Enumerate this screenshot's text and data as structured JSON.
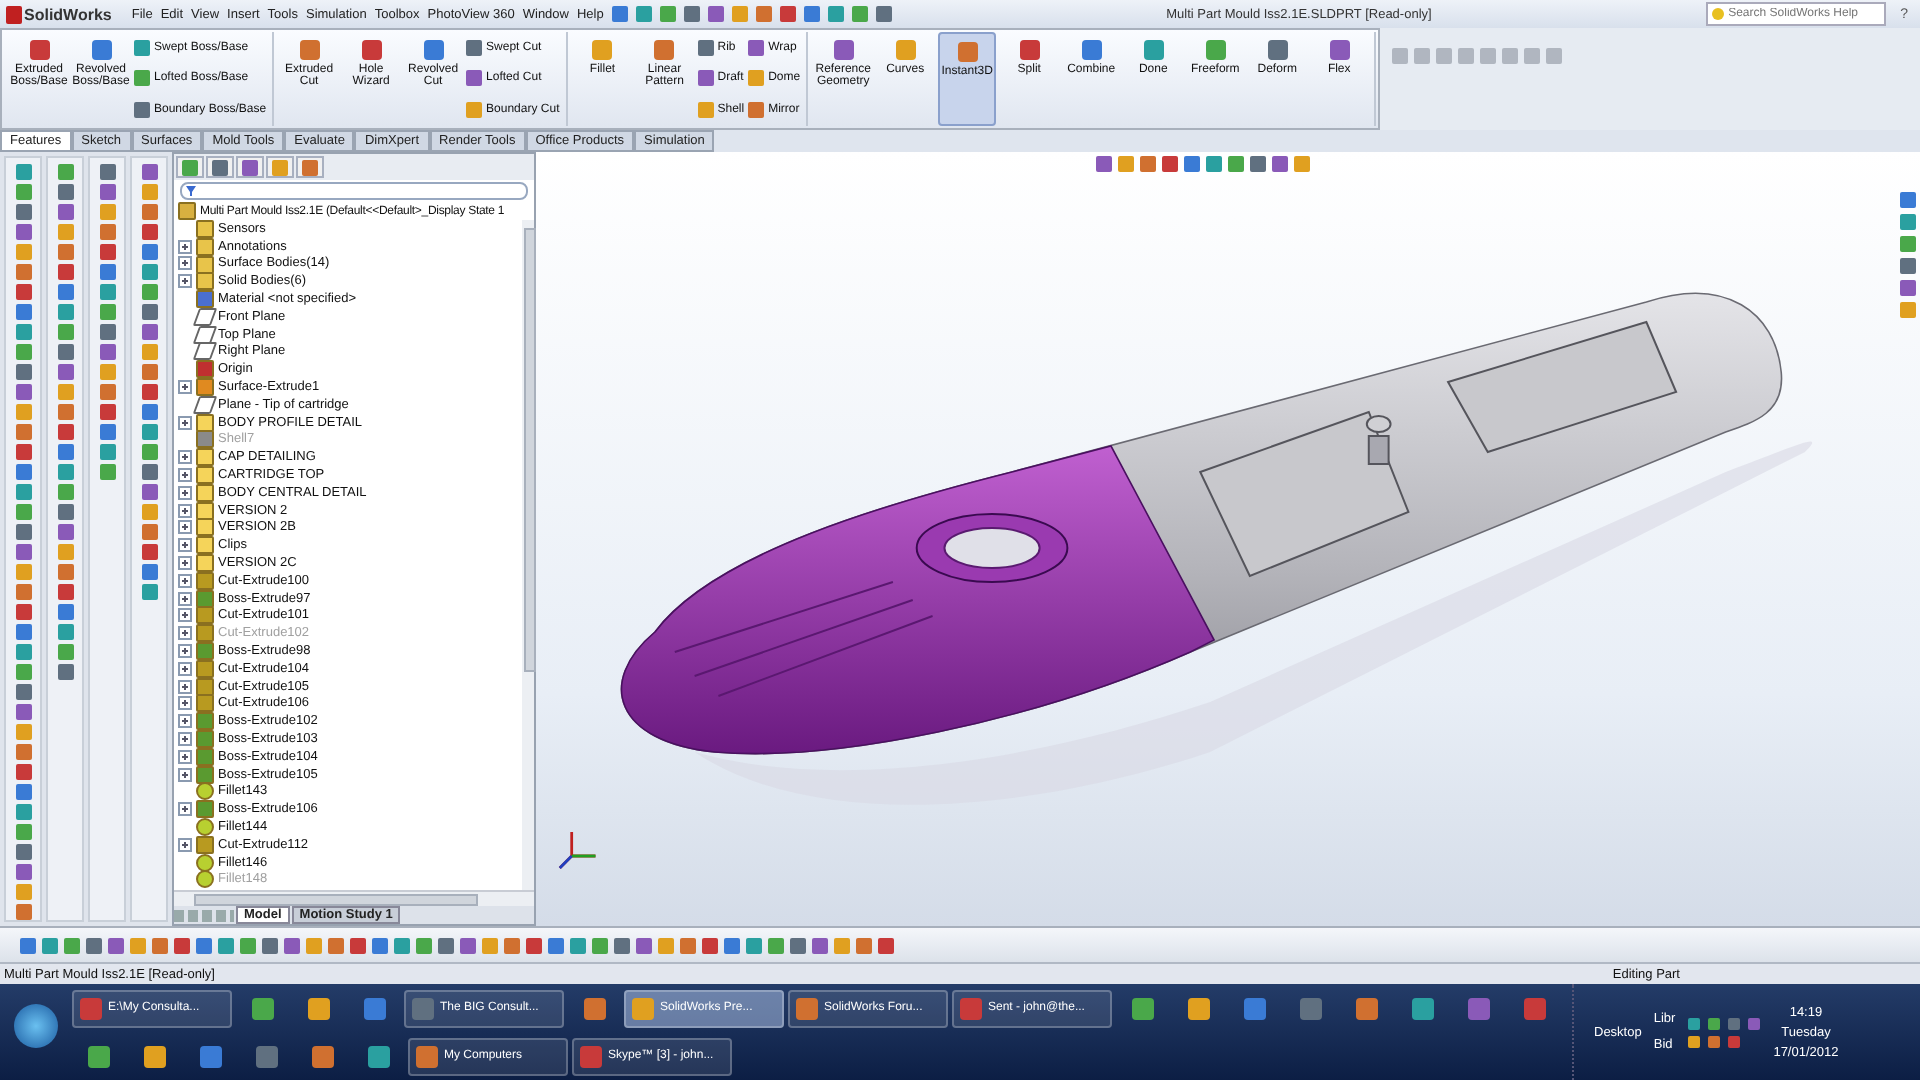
{
  "title_bar": {
    "logo": "SolidWorks",
    "menus": [
      "File",
      "Edit",
      "View",
      "Insert",
      "Tools",
      "Simulation",
      "Toolbox",
      "PhotoView 360",
      "Window",
      "Help"
    ],
    "title": "Multi Part Mould Iss2.1E.SLDPRT [Read-only]",
    "search": {
      "placeholder": "Search SolidWorks Help"
    },
    "help": "?"
  },
  "command_manager": {
    "groups": [
      [
        {
          "kind": "large",
          "label": "Extruded Boss/Base",
          "selected": false
        },
        {
          "kind": "large",
          "label": "Revolved Boss/Base",
          "selected": false
        },
        {
          "kind": "stack",
          "items": [
            "Swept Boss/Base",
            "Lofted Boss/Base",
            "Boundary Boss/Base"
          ]
        }
      ],
      [
        {
          "kind": "large",
          "label": "Extruded Cut",
          "selected": false
        },
        {
          "kind": "large",
          "label": "Hole Wizard",
          "selected": false
        },
        {
          "kind": "large",
          "label": "Revolved Cut",
          "selected": false
        },
        {
          "kind": "stack",
          "items": [
            "Swept Cut",
            "Lofted Cut",
            "Boundary Cut"
          ]
        }
      ],
      [
        {
          "kind": "large",
          "label": "Fillet",
          "selected": false
        },
        {
          "kind": "large",
          "label": "Linear Pattern",
          "selected": false
        },
        {
          "kind": "stack",
          "items": [
            "Rib",
            "Draft",
            "Shell"
          ]
        },
        {
          "kind": "stack",
          "items": [
            "Wrap",
            "Dome",
            "Mirror"
          ]
        }
      ],
      [
        {
          "kind": "large",
          "label": "Reference Geometry",
          "selected": false
        },
        {
          "kind": "large",
          "label": "Curves",
          "selected": false
        },
        {
          "kind": "large",
          "label": "Instant3D",
          "selected": true
        },
        {
          "kind": "large",
          "label": "Split",
          "selected": false
        },
        {
          "kind": "large",
          "label": "Combine",
          "selected": false
        },
        {
          "kind": "large",
          "label": "Done",
          "selected": false
        },
        {
          "kind": "large",
          "label": "Freeform",
          "selected": false
        },
        {
          "kind": "large",
          "label": "Deform",
          "selected": false
        },
        {
          "kind": "large",
          "label": "Flex",
          "selected": false
        }
      ]
    ]
  },
  "tabs": [
    {
      "label": "Features",
      "selected": true
    },
    {
      "label": "Sketch",
      "selected": false
    },
    {
      "label": "Surfaces",
      "selected": false
    },
    {
      "label": "Mold Tools",
      "selected": false
    },
    {
      "label": "Evaluate",
      "selected": false
    },
    {
      "label": "DimXpert",
      "selected": false
    },
    {
      "label": "Render Tools",
      "selected": false
    },
    {
      "label": "Office Products",
      "selected": false
    },
    {
      "label": "Simulation",
      "selected": false
    }
  ],
  "feature_tree": {
    "root": "Multi Part Mould Iss2.1E  (Default<<Default>_Display State 1",
    "items": [
      {
        "label": "Sensors",
        "kind": "sensor",
        "expandable": false,
        "suppressed": false
      },
      {
        "label": "Annotations",
        "kind": "annotation",
        "expandable": true,
        "suppressed": false
      },
      {
        "label": "Surface Bodies(14)",
        "kind": "bodies",
        "expandable": true,
        "suppressed": false
      },
      {
        "label": "Solid Bodies(6)",
        "kind": "bodies",
        "expandable": true,
        "suppressed": false
      },
      {
        "label": "Material <not specified>",
        "kind": "material",
        "expandable": false,
        "suppressed": false
      },
      {
        "label": "Front Plane",
        "kind": "plane",
        "expandable": false,
        "suppressed": false
      },
      {
        "label": "Top Plane",
        "kind": "plane",
        "expandable": false,
        "suppressed": false
      },
      {
        "label": "Right Plane",
        "kind": "plane",
        "expandable": false,
        "suppressed": false
      },
      {
        "label": "Origin",
        "kind": "origin",
        "expandable": false,
        "suppressed": false
      },
      {
        "label": "Surface-Extrude1",
        "kind": "surface",
        "expandable": true,
        "suppressed": false
      },
      {
        "label": "Plane - Tip of cartridge",
        "kind": "plane",
        "expandable": false,
        "suppressed": false
      },
      {
        "label": "BODY PROFILE DETAIL",
        "kind": "folder",
        "expandable": true,
        "suppressed": false
      },
      {
        "label": "Shell7",
        "kind": "shell",
        "expandable": false,
        "suppressed": true
      },
      {
        "label": "CAP DETAILING",
        "kind": "folder",
        "expandable": true,
        "suppressed": false
      },
      {
        "label": "CARTRIDGE TOP",
        "kind": "folder",
        "expandable": true,
        "suppressed": false
      },
      {
        "label": "BODY CENTRAL DETAIL",
        "kind": "folder",
        "expandable": true,
        "suppressed": false
      },
      {
        "label": "VERSION 2",
        "kind": "folder",
        "expandable": true,
        "suppressed": false
      },
      {
        "label": "VERSION 2B",
        "kind": "folder",
        "expandable": true,
        "suppressed": false
      },
      {
        "label": "Clips",
        "kind": "folder",
        "expandable": true,
        "suppressed": false
      },
      {
        "label": "VERSION 2C",
        "kind": "folder",
        "expandable": true,
        "suppressed": false
      },
      {
        "label": "Cut-Extrude100",
        "kind": "cut",
        "expandable": true,
        "suppressed": false
      },
      {
        "label": "Boss-Extrude97",
        "kind": "boss",
        "expandable": true,
        "suppressed": false
      },
      {
        "label": "Cut-Extrude101",
        "kind": "cut",
        "expandable": true,
        "suppressed": false
      },
      {
        "label": "Cut-Extrude102",
        "kind": "cut",
        "expandable": true,
        "suppressed": true
      },
      {
        "label": "Boss-Extrude98",
        "kind": "boss",
        "expandable": true,
        "suppressed": false
      },
      {
        "label": "Cut-Extrude104",
        "kind": "cut",
        "expandable": true,
        "suppressed": false
      },
      {
        "label": "Cut-Extrude105",
        "kind": "cut",
        "expandable": true,
        "suppressed": false
      },
      {
        "label": "Cut-Extrude106",
        "kind": "cut",
        "expandable": true,
        "suppressed": false
      },
      {
        "label": "Boss-Extrude102",
        "kind": "boss",
        "expandable": true,
        "suppressed": false
      },
      {
        "label": "Boss-Extrude103",
        "kind": "boss",
        "expandable": true,
        "suppressed": false
      },
      {
        "label": "Boss-Extrude104",
        "kind": "boss",
        "expandable": true,
        "suppressed": false
      },
      {
        "label": "Boss-Extrude105",
        "kind": "boss",
        "expandable": true,
        "suppressed": false
      },
      {
        "label": "Fillet143",
        "kind": "fillet",
        "expandable": false,
        "suppressed": false
      },
      {
        "label": "Boss-Extrude106",
        "kind": "boss",
        "expandable": true,
        "suppressed": false
      },
      {
        "label": "Fillet144",
        "kind": "fillet",
        "expandable": false,
        "suppressed": false
      },
      {
        "label": "Cut-Extrude112",
        "kind": "cut",
        "expandable": true,
        "suppressed": false
      },
      {
        "label": "Fillet146",
        "kind": "fillet",
        "expandable": false,
        "suppressed": false
      },
      {
        "label": "Fillet148",
        "kind": "fillet",
        "expandable": false,
        "suppressed": true
      }
    ]
  },
  "bottom_tabs": [
    {
      "label": "Model",
      "selected": true
    },
    {
      "label": "Motion Study 1",
      "selected": false
    }
  ],
  "status_bar": {
    "document": "Multi Part Mould Iss2.1E [Read-only]",
    "mode": "Editing Part"
  },
  "taskbar": {
    "items": [
      {
        "kind": "button",
        "label": "E:\\My Consulta...",
        "selected": false
      },
      {
        "kind": "icon",
        "selected": false
      },
      {
        "kind": "icon",
        "selected": false
      },
      {
        "kind": "icon",
        "selected": false
      },
      {
        "kind": "button",
        "label": "The BIG Consult...",
        "selected": false
      },
      {
        "kind": "icon",
        "selected": false
      },
      {
        "kind": "button",
        "label": "SolidWorks Pre...",
        "selected": true
      },
      {
        "kind": "button",
        "label": "SolidWorks Foru...",
        "selected": false
      },
      {
        "kind": "button",
        "label": "Sent - john@the...",
        "selected": false
      },
      {
        "kind": "icon",
        "selected": false
      },
      {
        "kind": "icon",
        "selected": false
      },
      {
        "kind": "icon",
        "selected": false
      },
      {
        "kind": "icon",
        "selected": false
      },
      {
        "kind": "icon",
        "selected": false
      },
      {
        "kind": "icon",
        "selected": false
      },
      {
        "kind": "icon",
        "selected": false
      },
      {
        "kind": "icon",
        "selected": false
      },
      {
        "kind": "icon",
        "selected": false
      },
      {
        "kind": "icon",
        "selected": false
      },
      {
        "kind": "icon",
        "selected": false
      },
      {
        "kind": "icon",
        "selected": false
      },
      {
        "kind": "icon",
        "selected": false
      },
      {
        "kind": "icon",
        "selected": false
      },
      {
        "kind": "button",
        "label": "My Computers",
        "selected": false
      },
      {
        "kind": "button",
        "label": "Skype™ [3] - john...",
        "selected": false
      }
    ]
  },
  "tray": {
    "toolbar": "Desktop",
    "shortcuts": [
      "Libr",
      "Bid"
    ],
    "time": "14:19",
    "day": "Tuesday",
    "date": "17/01/2012"
  }
}
